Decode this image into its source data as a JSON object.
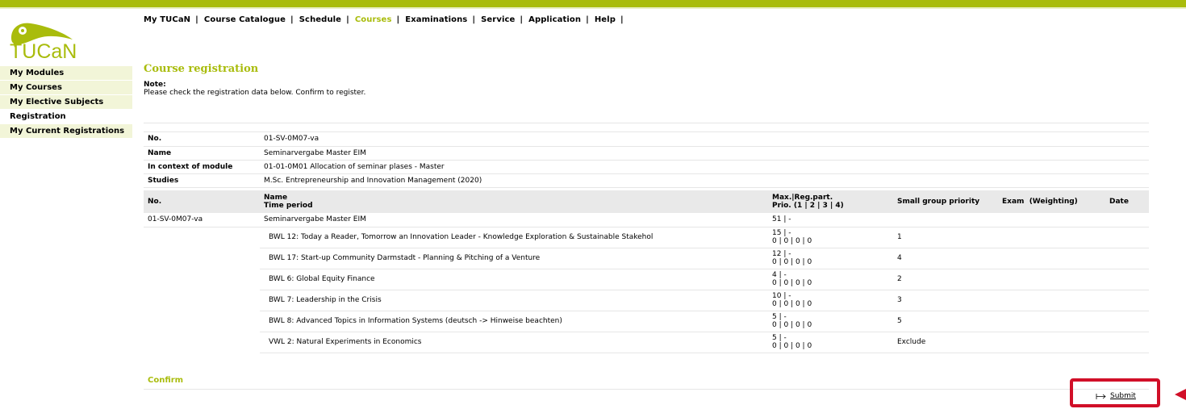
{
  "nav": {
    "items": [
      {
        "label": "My TUCaN",
        "active": false
      },
      {
        "label": "Course Catalogue",
        "active": false
      },
      {
        "label": "Schedule",
        "active": false
      },
      {
        "label": "Courses",
        "active": true
      },
      {
        "label": "Examinations",
        "active": false
      },
      {
        "label": "Service",
        "active": false
      },
      {
        "label": "Application",
        "active": false
      },
      {
        "label": "Help",
        "active": false
      }
    ],
    "separator": "|"
  },
  "logo": {
    "text": "TUCaN",
    "icon": "tucan-bird-logo"
  },
  "sidebar": {
    "items": [
      {
        "label": "My Modules"
      },
      {
        "label": "My Courses"
      },
      {
        "label": "My Elective Subjects"
      },
      {
        "label": "Registration"
      },
      {
        "label": "My Current Registrations"
      }
    ]
  },
  "page": {
    "title": "Course registration",
    "note_label": "Note:",
    "note_text": "Please check the registration data below. Confirm to register."
  },
  "info": {
    "rows": [
      {
        "key": "No.",
        "value": "01-SV-0M07-va"
      },
      {
        "key": "Name",
        "value": "Seminarvergabe Master EIM"
      },
      {
        "key": "In context of module",
        "value": "01-01-0M01 Allocation of seminar plases - Master"
      },
      {
        "key": "Studies",
        "value": "M.Sc. Entrepreneurship and Innovation Management (2020)"
      }
    ]
  },
  "table": {
    "headers": {
      "no": "No.",
      "name": "Name",
      "time": "Time period",
      "max": "Max.|Reg.part.",
      "prio": "Prio. (1 | 2 | 3 | 4)",
      "small_group": "Small group priority",
      "exam": "Exam",
      "weighting": "(Weighting)",
      "date": "Date"
    },
    "main_row": {
      "no": "01-SV-0M07-va",
      "name": "Seminarvergabe Master EIM",
      "max": "51 | -"
    },
    "sub_rows": [
      {
        "name": "BWL 12: Today a Reader, Tomorrow an Innovation Leader - Knowledge Exploration & Sustainable Stakehol",
        "max": "15 | -",
        "prio": "0 | 0 | 0 | 0",
        "priority": "1"
      },
      {
        "name": "BWL 17: Start-up Community Darmstadt - Planning & Pitching of a Venture",
        "max": "12 | -",
        "prio": "0 | 0 | 0 | 0",
        "priority": "4"
      },
      {
        "name": "BWL 6: Global Equity Finance",
        "max": "4 | -",
        "prio": "0 | 0 | 0 | 0",
        "priority": "2"
      },
      {
        "name": "BWL 7: Leadership in the Crisis",
        "max": "10 | -",
        "prio": "0 | 0 | 0 | 0",
        "priority": "3"
      },
      {
        "name": "BWL 8: Advanced Topics in Information Systems (deutsch -> Hinweise beachten)",
        "max": "5 | -",
        "prio": "0 | 0 | 0 | 0",
        "priority": "5"
      },
      {
        "name": "VWL 2: Natural Experiments in Economics",
        "max": "5 | -",
        "prio": "0 | 0 | 0 | 0",
        "priority": "Exclude"
      }
    ]
  },
  "confirm": {
    "label": "Confirm",
    "submit_label": "Submit",
    "submit_icon": "submit-arrow-icon"
  },
  "colors": {
    "brand": "#a9bc0c",
    "highlight": "#d10f28",
    "sidebar_bg": "#f2f5d8"
  }
}
